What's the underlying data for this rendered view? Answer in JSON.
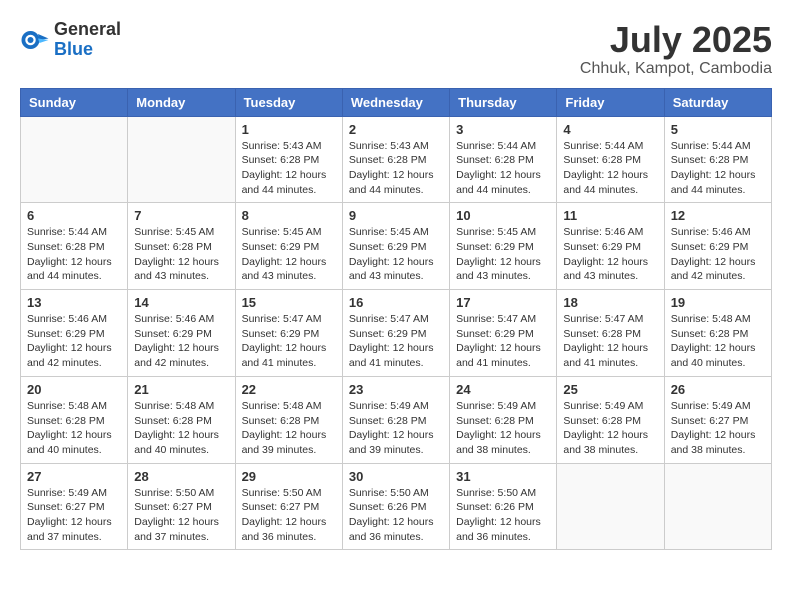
{
  "header": {
    "logo_general": "General",
    "logo_blue": "Blue",
    "month_year": "July 2025",
    "location": "Chhuk, Kampot, Cambodia"
  },
  "weekdays": [
    "Sunday",
    "Monday",
    "Tuesday",
    "Wednesday",
    "Thursday",
    "Friday",
    "Saturday"
  ],
  "weeks": [
    [
      {
        "day": "",
        "sunrise": "",
        "sunset": "",
        "daylight": ""
      },
      {
        "day": "",
        "sunrise": "",
        "sunset": "",
        "daylight": ""
      },
      {
        "day": "1",
        "sunrise": "Sunrise: 5:43 AM",
        "sunset": "Sunset: 6:28 PM",
        "daylight": "Daylight: 12 hours and 44 minutes."
      },
      {
        "day": "2",
        "sunrise": "Sunrise: 5:43 AM",
        "sunset": "Sunset: 6:28 PM",
        "daylight": "Daylight: 12 hours and 44 minutes."
      },
      {
        "day": "3",
        "sunrise": "Sunrise: 5:44 AM",
        "sunset": "Sunset: 6:28 PM",
        "daylight": "Daylight: 12 hours and 44 minutes."
      },
      {
        "day": "4",
        "sunrise": "Sunrise: 5:44 AM",
        "sunset": "Sunset: 6:28 PM",
        "daylight": "Daylight: 12 hours and 44 minutes."
      },
      {
        "day": "5",
        "sunrise": "Sunrise: 5:44 AM",
        "sunset": "Sunset: 6:28 PM",
        "daylight": "Daylight: 12 hours and 44 minutes."
      }
    ],
    [
      {
        "day": "6",
        "sunrise": "Sunrise: 5:44 AM",
        "sunset": "Sunset: 6:28 PM",
        "daylight": "Daylight: 12 hours and 44 minutes."
      },
      {
        "day": "7",
        "sunrise": "Sunrise: 5:45 AM",
        "sunset": "Sunset: 6:28 PM",
        "daylight": "Daylight: 12 hours and 43 minutes."
      },
      {
        "day": "8",
        "sunrise": "Sunrise: 5:45 AM",
        "sunset": "Sunset: 6:29 PM",
        "daylight": "Daylight: 12 hours and 43 minutes."
      },
      {
        "day": "9",
        "sunrise": "Sunrise: 5:45 AM",
        "sunset": "Sunset: 6:29 PM",
        "daylight": "Daylight: 12 hours and 43 minutes."
      },
      {
        "day": "10",
        "sunrise": "Sunrise: 5:45 AM",
        "sunset": "Sunset: 6:29 PM",
        "daylight": "Daylight: 12 hours and 43 minutes."
      },
      {
        "day": "11",
        "sunrise": "Sunrise: 5:46 AM",
        "sunset": "Sunset: 6:29 PM",
        "daylight": "Daylight: 12 hours and 43 minutes."
      },
      {
        "day": "12",
        "sunrise": "Sunrise: 5:46 AM",
        "sunset": "Sunset: 6:29 PM",
        "daylight": "Daylight: 12 hours and 42 minutes."
      }
    ],
    [
      {
        "day": "13",
        "sunrise": "Sunrise: 5:46 AM",
        "sunset": "Sunset: 6:29 PM",
        "daylight": "Daylight: 12 hours and 42 minutes."
      },
      {
        "day": "14",
        "sunrise": "Sunrise: 5:46 AM",
        "sunset": "Sunset: 6:29 PM",
        "daylight": "Daylight: 12 hours and 42 minutes."
      },
      {
        "day": "15",
        "sunrise": "Sunrise: 5:47 AM",
        "sunset": "Sunset: 6:29 PM",
        "daylight": "Daylight: 12 hours and 41 minutes."
      },
      {
        "day": "16",
        "sunrise": "Sunrise: 5:47 AM",
        "sunset": "Sunset: 6:29 PM",
        "daylight": "Daylight: 12 hours and 41 minutes."
      },
      {
        "day": "17",
        "sunrise": "Sunrise: 5:47 AM",
        "sunset": "Sunset: 6:29 PM",
        "daylight": "Daylight: 12 hours and 41 minutes."
      },
      {
        "day": "18",
        "sunrise": "Sunrise: 5:47 AM",
        "sunset": "Sunset: 6:28 PM",
        "daylight": "Daylight: 12 hours and 41 minutes."
      },
      {
        "day": "19",
        "sunrise": "Sunrise: 5:48 AM",
        "sunset": "Sunset: 6:28 PM",
        "daylight": "Daylight: 12 hours and 40 minutes."
      }
    ],
    [
      {
        "day": "20",
        "sunrise": "Sunrise: 5:48 AM",
        "sunset": "Sunset: 6:28 PM",
        "daylight": "Daylight: 12 hours and 40 minutes."
      },
      {
        "day": "21",
        "sunrise": "Sunrise: 5:48 AM",
        "sunset": "Sunset: 6:28 PM",
        "daylight": "Daylight: 12 hours and 40 minutes."
      },
      {
        "day": "22",
        "sunrise": "Sunrise: 5:48 AM",
        "sunset": "Sunset: 6:28 PM",
        "daylight": "Daylight: 12 hours and 39 minutes."
      },
      {
        "day": "23",
        "sunrise": "Sunrise: 5:49 AM",
        "sunset": "Sunset: 6:28 PM",
        "daylight": "Daylight: 12 hours and 39 minutes."
      },
      {
        "day": "24",
        "sunrise": "Sunrise: 5:49 AM",
        "sunset": "Sunset: 6:28 PM",
        "daylight": "Daylight: 12 hours and 38 minutes."
      },
      {
        "day": "25",
        "sunrise": "Sunrise: 5:49 AM",
        "sunset": "Sunset: 6:28 PM",
        "daylight": "Daylight: 12 hours and 38 minutes."
      },
      {
        "day": "26",
        "sunrise": "Sunrise: 5:49 AM",
        "sunset": "Sunset: 6:27 PM",
        "daylight": "Daylight: 12 hours and 38 minutes."
      }
    ],
    [
      {
        "day": "27",
        "sunrise": "Sunrise: 5:49 AM",
        "sunset": "Sunset: 6:27 PM",
        "daylight": "Daylight: 12 hours and 37 minutes."
      },
      {
        "day": "28",
        "sunrise": "Sunrise: 5:50 AM",
        "sunset": "Sunset: 6:27 PM",
        "daylight": "Daylight: 12 hours and 37 minutes."
      },
      {
        "day": "29",
        "sunrise": "Sunrise: 5:50 AM",
        "sunset": "Sunset: 6:27 PM",
        "daylight": "Daylight: 12 hours and 36 minutes."
      },
      {
        "day": "30",
        "sunrise": "Sunrise: 5:50 AM",
        "sunset": "Sunset: 6:26 PM",
        "daylight": "Daylight: 12 hours and 36 minutes."
      },
      {
        "day": "31",
        "sunrise": "Sunrise: 5:50 AM",
        "sunset": "Sunset: 6:26 PM",
        "daylight": "Daylight: 12 hours and 36 minutes."
      },
      {
        "day": "",
        "sunrise": "",
        "sunset": "",
        "daylight": ""
      },
      {
        "day": "",
        "sunrise": "",
        "sunset": "",
        "daylight": ""
      }
    ]
  ]
}
